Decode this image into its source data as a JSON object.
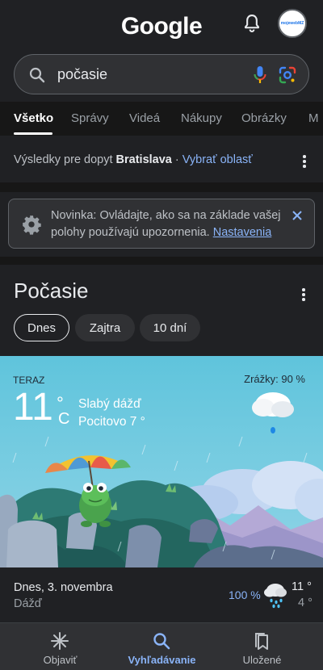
{
  "header": {
    "logo": "Google",
    "avatar_text": "mojewebMZ"
  },
  "search": {
    "query": "počasie"
  },
  "tabs": [
    {
      "label": "Všetko",
      "active": true
    },
    {
      "label": "Správy"
    },
    {
      "label": "Videá"
    },
    {
      "label": "Nákupy"
    },
    {
      "label": "Obrázky"
    },
    {
      "label": "M"
    }
  ],
  "location": {
    "prefix": "Výsledky pre dopyt",
    "city": "Bratislava",
    "separator": "·",
    "change_link": "Vybrať oblasť"
  },
  "notice": {
    "text": "Novinka: Ovládajte, ako sa na základe vašej polohy používajú upozornenia.",
    "link": "Nastavenia"
  },
  "weather": {
    "title": "Počasie",
    "pills": [
      "Dnes",
      "Zajtra",
      "10 dní"
    ],
    "now_label": "TERAZ",
    "temperature": "11",
    "degree": "°",
    "unit": "C",
    "condition": "Slabý dážď",
    "feels_like": "Pocitovo 7 °",
    "precipitation": "Zrážky: 90 %"
  },
  "forecast": {
    "date": "Dnes, 3. novembra",
    "condition": "Dážď",
    "chance": "100 %",
    "high": "11 °",
    "low": "4 °"
  },
  "bottom_nav": [
    {
      "label": "Objaviť",
      "icon": "asterisk-icon"
    },
    {
      "label": "Vyhľadávanie",
      "icon": "search-icon",
      "active": true
    },
    {
      "label": "Uložené",
      "icon": "bookmarks-icon"
    }
  ],
  "colors": {
    "background": "#202124",
    "surface": "#303134",
    "link": "#8ab4f8",
    "sky": "#5bbfd6"
  }
}
